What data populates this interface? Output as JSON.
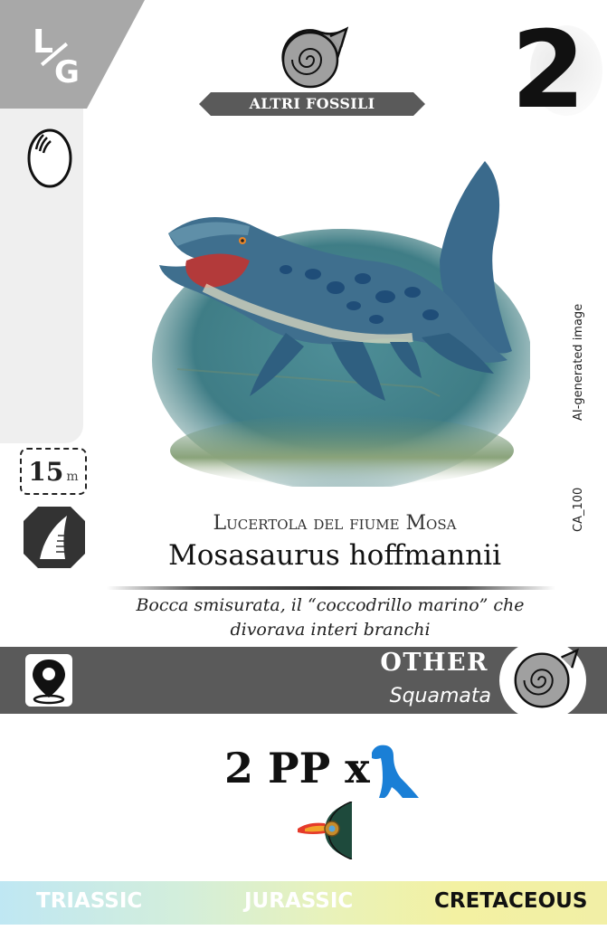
{
  "card": {
    "corner_l": "L",
    "corner_g": "G",
    "cost": "2",
    "category_label": "ALTRI FOSSILI",
    "size_value": "15",
    "size_unit": "m",
    "common_name": "Lucertola del fiume Mosa",
    "scientific_name": "Mosasaurus hoffmannii",
    "description": "Bocca smisurata, il “coccodrillo marino” che divorava interi branchi",
    "group": "OTHER",
    "order": "Squamata",
    "points": "2 PP x",
    "ai_note": "AI-generated image",
    "card_code": "CA_100",
    "eras": [
      "TRIASSIC",
      "JURASSIC",
      "CRETACEOUS"
    ],
    "active_era": "CRETACEOUS",
    "icons": [
      "egg-icon",
      "tooth-icon",
      "location-pin-icon",
      "ammonite-icon",
      "sauropod-icon",
      "meteor-icon"
    ],
    "colors": {
      "info_bar": "#5a5a5a",
      "sauropod": "#1a7fd6",
      "sidebar": "#efefef",
      "corner": "#a8a8a8"
    }
  }
}
